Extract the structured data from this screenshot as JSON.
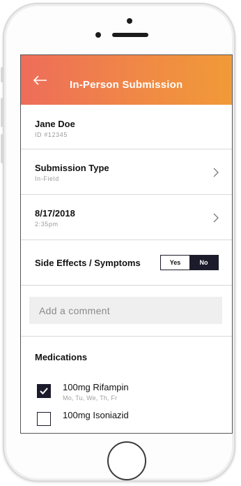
{
  "header": {
    "title": "In-Person Submission"
  },
  "patient": {
    "name": "Jane Doe",
    "id": "ID #12345"
  },
  "submission_type": {
    "label": "Submission Type",
    "value": "In-Field"
  },
  "date_row": {
    "date": "8/17/2018",
    "time": "2:35pm"
  },
  "side_effects": {
    "label": "Side Effects / Symptoms",
    "yes_label": "Yes",
    "no_label": "No",
    "selected": "No"
  },
  "comment": {
    "placeholder": "Add a comment",
    "value": ""
  },
  "medications": {
    "title": "Medications",
    "items": [
      {
        "name": "100mg Rifampin",
        "days": "Mo, Tu, We, Th, Fr",
        "checked": true
      },
      {
        "name": "100mg Isoniazid",
        "days": "",
        "checked": false
      }
    ]
  },
  "colors": {
    "header_start": "#ee6d5a",
    "header_end": "#f19a38",
    "dark": "#1b1b2b"
  }
}
